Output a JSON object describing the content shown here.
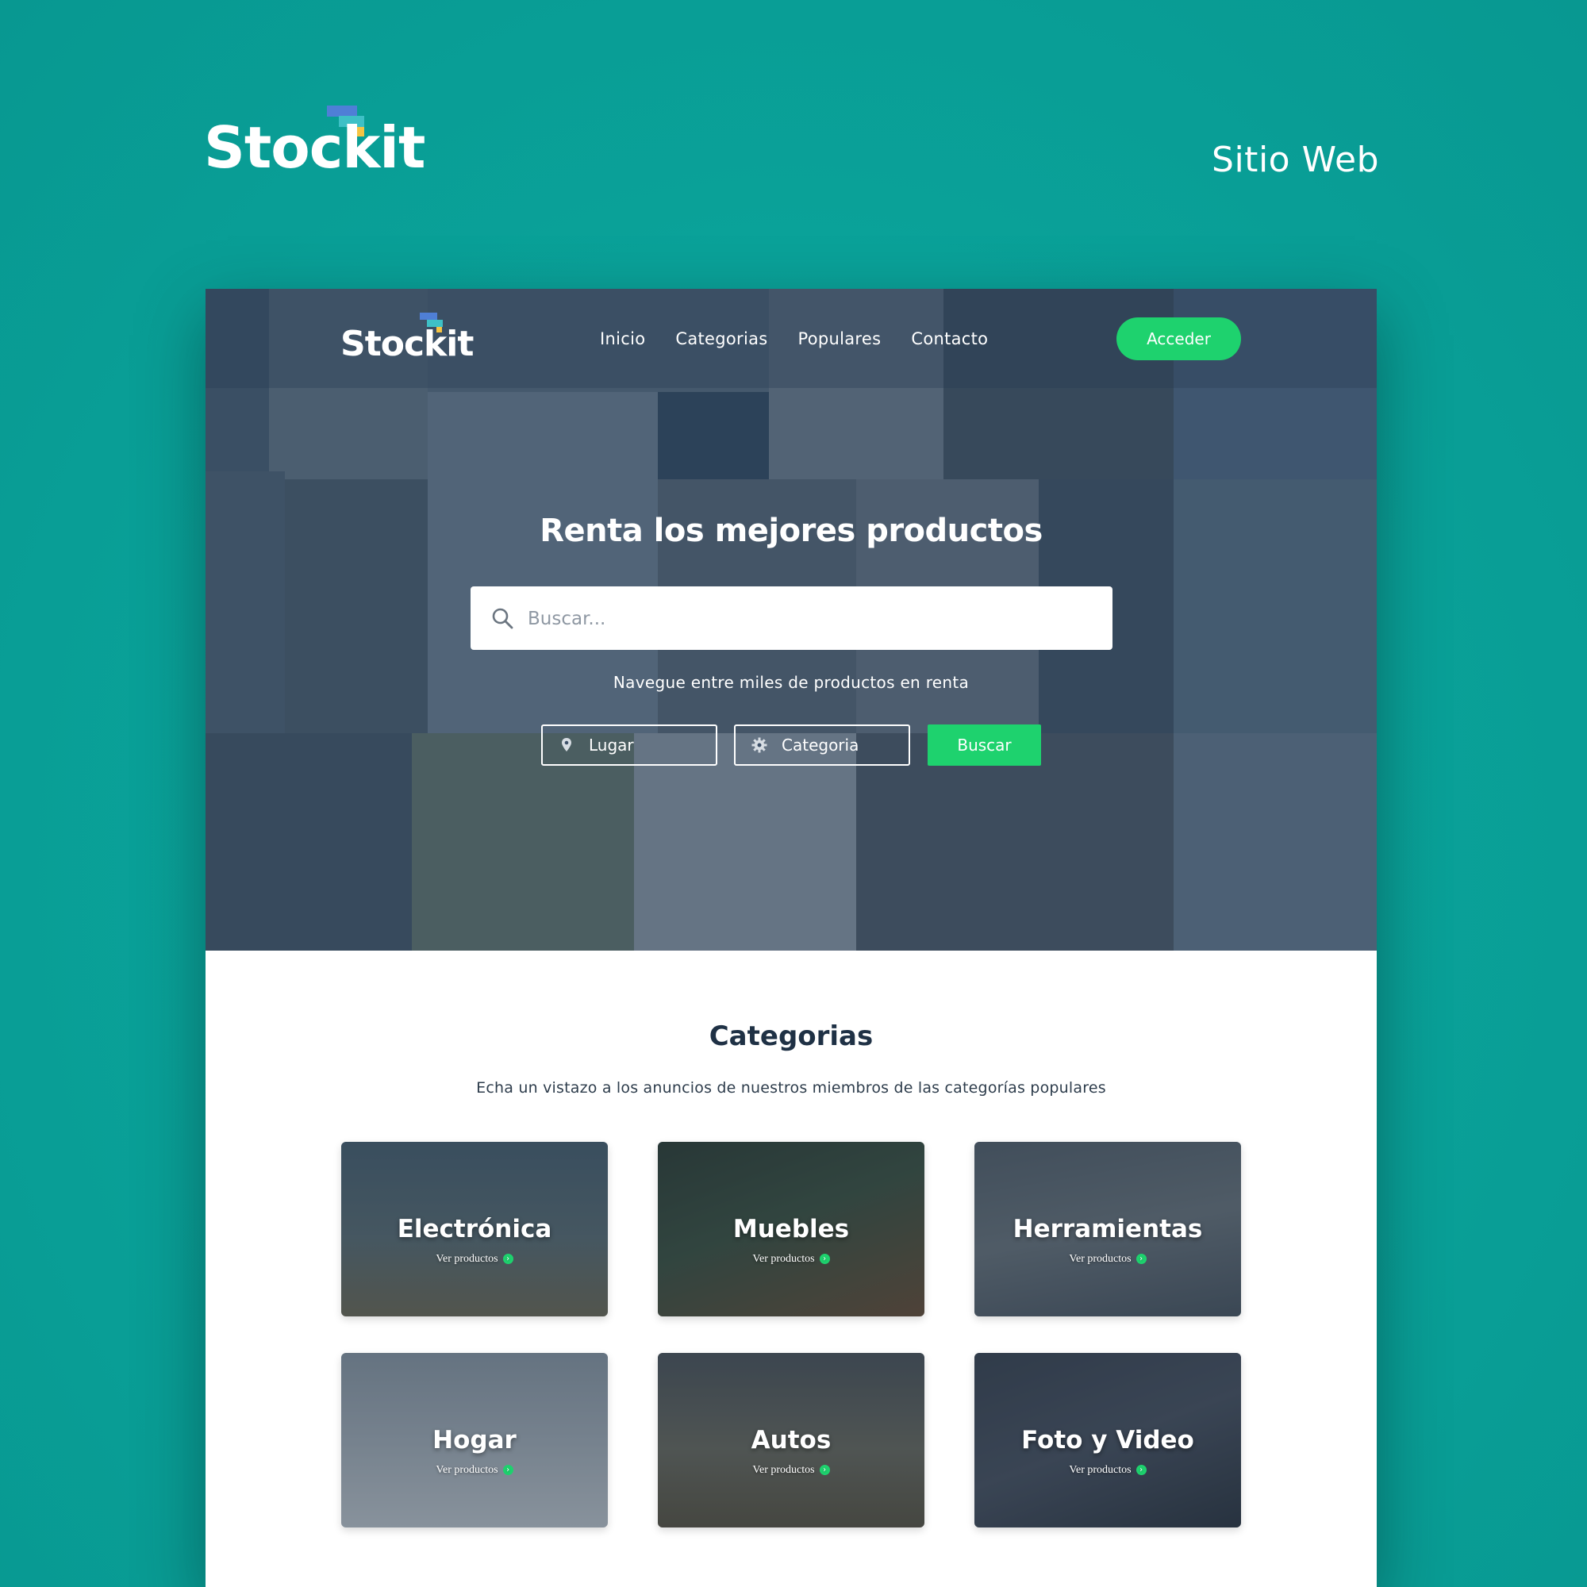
{
  "presentation": {
    "brand_name": "Stockit",
    "tagline": "Sitio Web"
  },
  "nav": {
    "logo": "Stockit",
    "links": [
      "Inicio",
      "Categorias",
      "Populares",
      "Contacto"
    ],
    "cta": "Acceder"
  },
  "hero": {
    "title": "Renta los mejores productos",
    "search_placeholder": "Buscar...",
    "subtitle": "Navegue entre miles de productos en renta",
    "filters": {
      "place": "Lugar",
      "category": "Categoria"
    },
    "search_button": "Buscar"
  },
  "categories": {
    "title": "Categorias",
    "subtitle": "Echa un vistazo a los anuncios de nuestros miembros de las categorías populares",
    "link_label": "Ver productos",
    "items": [
      {
        "name": "Electrónica"
      },
      {
        "name": "Muebles"
      },
      {
        "name": "Herramientas"
      },
      {
        "name": "Hogar"
      },
      {
        "name": "Autos"
      },
      {
        "name": "Foto y Video"
      }
    ]
  },
  "colors": {
    "background_teal": "#0aa39a",
    "accent_green": "#1ed26e",
    "hero_overlay": "#364d63",
    "heading_dark": "#1f3145",
    "logo_blue": "#4f7fd6",
    "logo_teal": "#3ec0c6",
    "logo_yellow": "#f6c443"
  },
  "icons": {
    "search": "search-icon",
    "place": "map-pin-icon",
    "category": "gear-icon",
    "card_arrow": "chevron-right-icon"
  }
}
